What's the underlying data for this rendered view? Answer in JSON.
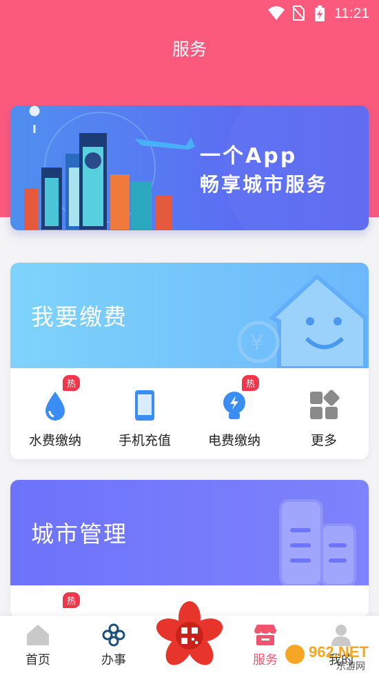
{
  "status": {
    "time": "11:21"
  },
  "header": {
    "title": "服务"
  },
  "banner": {
    "line1": "一个App",
    "line2": "畅享城市服务"
  },
  "pay_section": {
    "title": "我要缴费",
    "items": [
      {
        "label": "水费缴纳",
        "badge": "热",
        "icon": "water-drop-icon"
      },
      {
        "label": "手机充值",
        "badge": "",
        "icon": "phone-icon"
      },
      {
        "label": "电费缴纳",
        "badge": "热",
        "icon": "lightbulb-icon"
      },
      {
        "label": "更多",
        "badge": "",
        "icon": "grid-more-icon"
      }
    ]
  },
  "city_section": {
    "title": "城市管理",
    "items": [
      {
        "badge": "热"
      }
    ]
  },
  "tabbar": {
    "items": [
      {
        "label": "首页",
        "icon": "home-icon"
      },
      {
        "label": "办事",
        "icon": "knot-icon"
      },
      {
        "label": "",
        "icon": "qr-code-flower-icon"
      },
      {
        "label": "服务",
        "icon": "shop-icon"
      },
      {
        "label": "我的",
        "icon": "user-icon"
      }
    ]
  },
  "watermark": {
    "text": "962.NET",
    "subtext": "乐游网"
  },
  "colors": {
    "brand": "#fb5a7d",
    "accent_blue": "#5b6ff2",
    "hot_badge": "#f0364b",
    "active_tab": "#f0546f"
  }
}
